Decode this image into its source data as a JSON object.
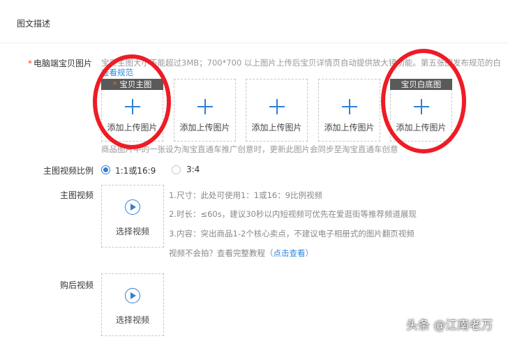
{
  "section": {
    "title": "图文描述"
  },
  "main_images": {
    "label": "电脑端宝贝图片",
    "required_mark": "*",
    "hint_line1": "宝贝主图大小不能超过3MB；700*700 以上图片上传后宝贝详情页自动提供放大镜功能。第五张图发布规范的白",
    "hint_link": "查看规范",
    "slots": [
      {
        "tag": "宝贝主图",
        "tag_required": "*",
        "add_label": "添加上传图片"
      },
      {
        "tag": "",
        "add_label": "添加上传图片"
      },
      {
        "tag": "",
        "add_label": "添加上传图片"
      },
      {
        "tag": "",
        "add_label": "添加上传图片"
      },
      {
        "tag": "宝贝白底图",
        "add_label": "添加上传图片"
      }
    ],
    "bottom_hint": "商品图片中的一张设为淘宝直通车推广创意时，更新此图片会同步至淘宝直通车创意"
  },
  "video_ratio": {
    "label": "主图视频比例",
    "options": [
      {
        "label": "1:1或16:9",
        "selected": true
      },
      {
        "label": "3:4",
        "selected": false
      }
    ]
  },
  "main_video": {
    "label": "主图视频",
    "button_label": "选择视频",
    "info": [
      "1.尺寸：此处可使用1：1或16：9比例视频",
      "2.时长：≤60s，建议30秒以内短视频可优先在爱逛街等推荐频道展现",
      "3.内容：突出商品1-2个核心卖点，不建议电子相册式的图片翻页视频"
    ],
    "tutorial_prefix": "视频不会拍？查看完整教程（",
    "tutorial_link": "点击查看",
    "tutorial_suffix": "）"
  },
  "after_video": {
    "label": "购后视频",
    "button_label": "选择视频"
  },
  "watermark": {
    "text": "头条 @江南老万"
  },
  "colors": {
    "accent": "#2f80d3",
    "annotation": "#ee1c25",
    "required": "#ff3b30"
  }
}
